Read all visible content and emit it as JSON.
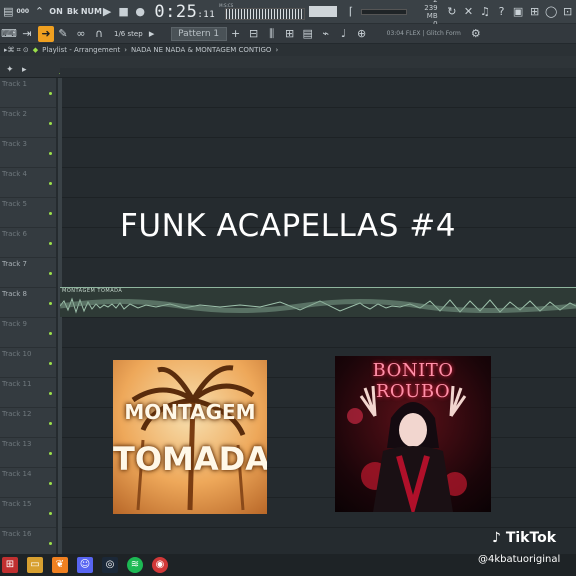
{
  "toolbar": {
    "left_label": "000",
    "mode_labels": [
      "SONG",
      "ON",
      "Bk",
      "NUM"
    ],
    "time_main": "0:25",
    "time_sub": ":11",
    "time_unit": "M:S:CS",
    "stat_cpu": "2",
    "stat_mem": "239 MB",
    "stat_voices": "0"
  },
  "toolbar2": {
    "step_label": "1/6 step",
    "pattern_label": "Pattern 1",
    "flex_label": "03:04 FLEX | Glitch Form"
  },
  "breadcrumb": {
    "window": "Playlist - Arrangement",
    "project": "NADA NE NADA & MONTAGEM CONTIGO"
  },
  "tracks": [
    {
      "name": "Track 1"
    },
    {
      "name": "Track 2"
    },
    {
      "name": "Track 3"
    },
    {
      "name": "Track 4"
    },
    {
      "name": "Track 5"
    },
    {
      "name": "Track 6"
    },
    {
      "name": "Track 7"
    },
    {
      "name": "Track 8"
    },
    {
      "name": "Track 9"
    },
    {
      "name": "Track 10"
    },
    {
      "name": "Track 11"
    },
    {
      "name": "Track 12"
    },
    {
      "name": "Track 13"
    },
    {
      "name": "Track 14"
    },
    {
      "name": "Track 15"
    },
    {
      "name": "Track 16"
    }
  ],
  "clip": {
    "title": "MONTAGEM TOMADA"
  },
  "overlay": {
    "title": "FUNK ACAPELLAS #4"
  },
  "covers": {
    "left_text_1": "MONTAGEM",
    "left_text_2": "TOMADA",
    "right_text": "BONITO ROUBO"
  },
  "watermark": {
    "brand": "TikTok",
    "user": "@4kbatuoriginal"
  },
  "colors": {
    "accent": "#f0a020",
    "clip_wave": "#8fb59e",
    "track_dot": "#9be04a"
  }
}
